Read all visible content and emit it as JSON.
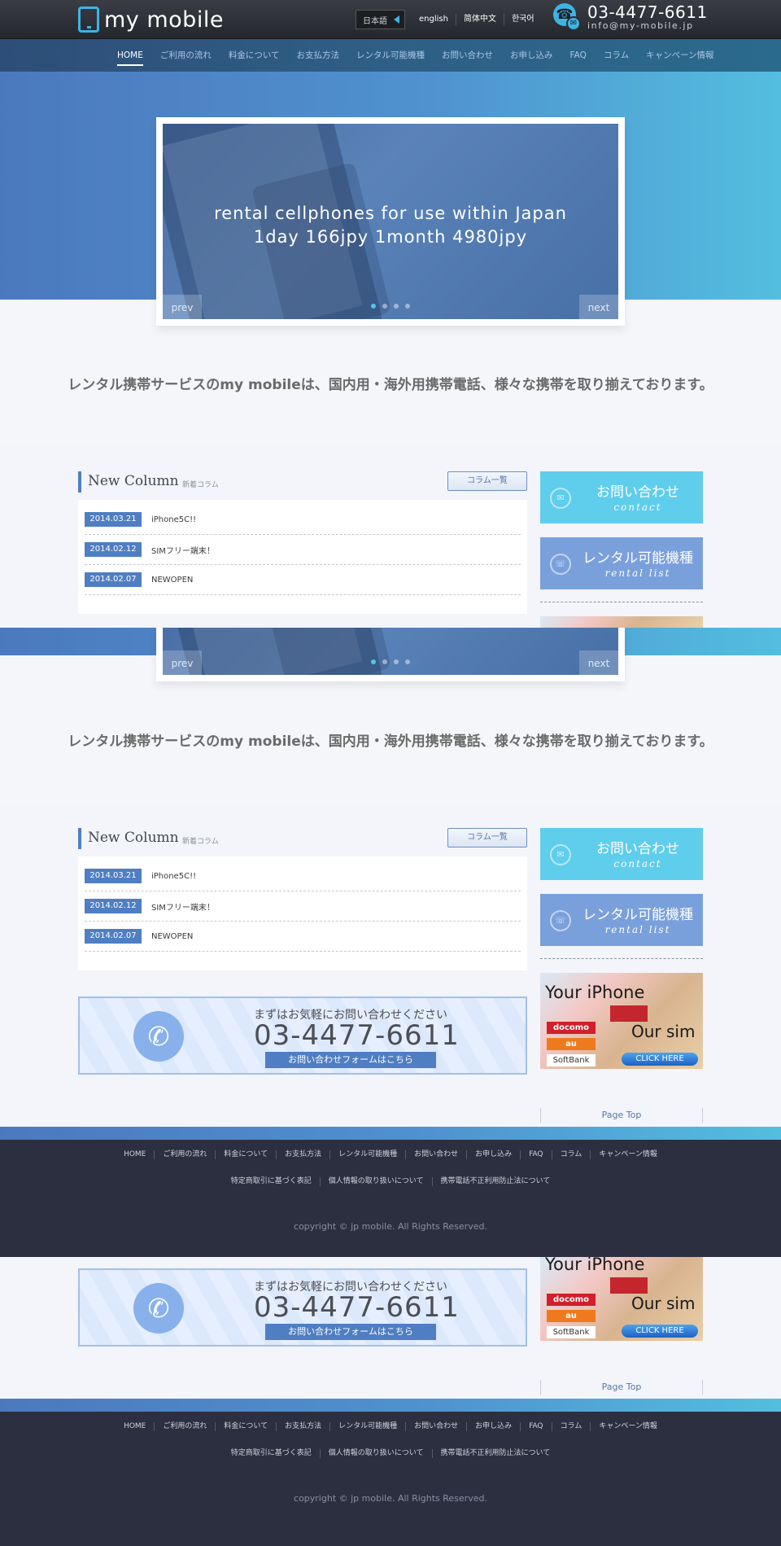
{
  "header": {
    "logo_text": "my mobile",
    "languages": {
      "current": "日本語",
      "items": [
        "english",
        "简体中文",
        "한국어"
      ]
    },
    "contact": {
      "phone": "03-4477-6611",
      "email": "info@my-mobile.jp"
    }
  },
  "nav": {
    "items": [
      "HOME",
      "ご利用の流れ",
      "料金について",
      "お支払方法",
      "レンタル可能機種",
      "お問い合わせ",
      "お申し込み",
      "FAQ",
      "コラム",
      "キャンペーン情報"
    ]
  },
  "slider": {
    "line1": "rental cellphones for use within Japan",
    "line2": "1day 166jpy 1month 4980jpy",
    "prev": "prev",
    "next": "next"
  },
  "tagline": "レンタル携帯サービスのmy mobileは、国内用・海外用携帯電話、様々な携帯を取り揃えております。",
  "column": {
    "title": "New Column",
    "subtitle": "新着コラム",
    "list_button": "コラム一覧",
    "items": [
      {
        "date": "2014.03.21",
        "title": "iPhone5C!!"
      },
      {
        "date": "2014.02.12",
        "title": "SIMフリー端末！"
      },
      {
        "date": "2014.02.07",
        "title": "NEWOPEN"
      }
    ]
  },
  "sidebar": {
    "contact_button": {
      "main": "お問い合わせ",
      "sub": "contact"
    },
    "rental_button": {
      "main": "レンタル可能機種",
      "sub": "rental list"
    },
    "ad": {
      "top": "Your iPhone",
      "bottom": "Our sim",
      "carriers": [
        "docomo",
        "au",
        "SoftBank"
      ],
      "cta": "CLICK HERE"
    }
  },
  "call_banner": {
    "lead": "まずはお気軽にお問い合わせください",
    "number": "03-4477-6611",
    "button": "お問い合わせフォームはこちら"
  },
  "page_top": "Page Top",
  "footer": {
    "links": [
      "HOME",
      "ご利用の流れ",
      "料金について",
      "お支払方法",
      "レンタル可能機種",
      "お問い合わせ",
      "お申し込み",
      "FAQ",
      "コラム",
      "キャンペーン情報"
    ],
    "legal": [
      "特定商取引に基づく表記",
      "個人情報の取り扱いについて",
      "携帯電話不正利用防止法について"
    ],
    "copyright": "copyright © jp mobile. All Rights Reserved."
  },
  "colors": {
    "accent": "#3fb3e4",
    "nav_blue": "#2f5f86",
    "date_badge": "#4f7ec2",
    "contact_cyan": "#5fcdec",
    "rental_blue": "#7aa0dc",
    "footer_bg": "#2c2f40"
  }
}
